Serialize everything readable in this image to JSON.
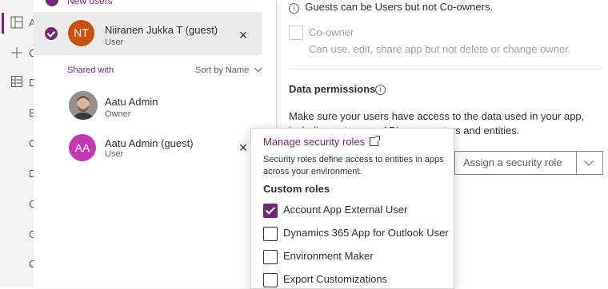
{
  "nav": {
    "letters": [
      "A",
      "C",
      "D",
      "E",
      "C",
      "D",
      "C",
      "C",
      "C"
    ]
  },
  "share_panel": {
    "new_users_label": "New users",
    "selected_user": {
      "initials": "NT",
      "name": "Niiranen Jukka T (guest)",
      "role": "User",
      "avatar_color": "#ca5010"
    },
    "shared_with_label": "Shared with",
    "sort_label": "Sort by Name",
    "shared_users": [
      {
        "name": "Aatu Admin",
        "role": "Owner"
      },
      {
        "initials": "AA",
        "name": "Aatu Admin (guest)",
        "role": "User",
        "avatar_color": "#c239b3"
      }
    ]
  },
  "settings": {
    "guest_note": "Guests can be Users but not Co-owners.",
    "coowner_label": "Co-owner",
    "coowner_desc": "Can use, edit, share app but not delete or change owner.",
    "data_permissions_title": "Data permissions",
    "data_permissions_desc": "Make sure your users have access to the data used in your app, including gateways, APIs, connectors and entities.",
    "role_select_placeholder": "Assign a security role"
  },
  "callout": {
    "title": "Manage security roles",
    "desc": "Security roles define access to entities in apps across your environment.",
    "custom_roles_label": "Custom roles",
    "roles": [
      {
        "label": "Account App External User",
        "checked": true
      },
      {
        "label": "Dynamics 365 App for Outlook User",
        "checked": false
      },
      {
        "label": "Environment Maker",
        "checked": false
      },
      {
        "label": "Export Customizations",
        "checked": false
      }
    ]
  },
  "colors": {
    "accent": "#742774"
  }
}
